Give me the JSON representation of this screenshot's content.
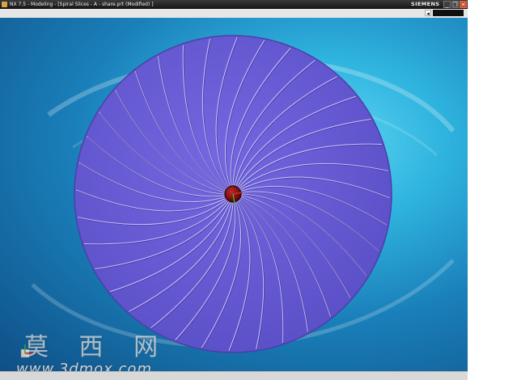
{
  "window": {
    "title": "NX 7.5 - Modeling - [Spiral Slices - A - share.prt (Modified) ]",
    "brand": "SIEMENS",
    "controls": {
      "minimize": "_",
      "restore": "❐",
      "close": "✕"
    }
  },
  "toolbar": {
    "menu_arrow": "◂"
  },
  "watermark": {
    "text": "莫 西 网",
    "url": "www.3dmox.com"
  },
  "colors": {
    "blade_fill": "#6b5fd6",
    "blade_edge": "#d9d6ff",
    "hub": "#8a0d0d",
    "background_accent": "#2fb4df"
  },
  "model": {
    "blade_count": 36,
    "icon": "coordinate-axes-icon"
  }
}
